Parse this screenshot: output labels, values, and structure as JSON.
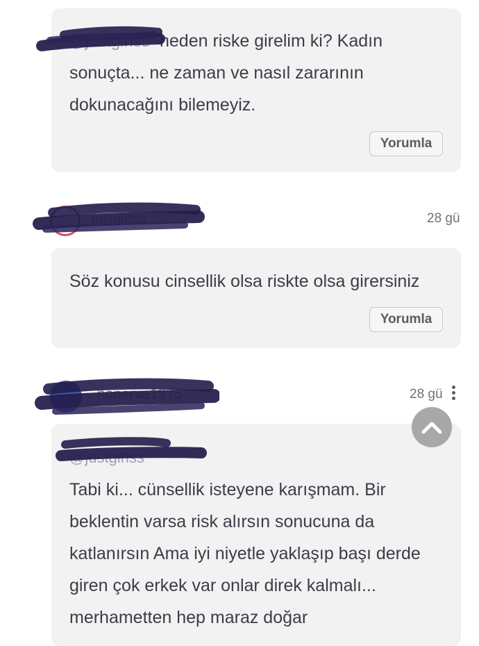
{
  "comments": [
    {
      "mention": "@justgirlss",
      "text_line1": "neden riske girelim ki? Kadın",
      "text_line2": "sonuçta... ne zaman ve nasıl zararının",
      "text_line3": "dokunacağını bilemeyiz.",
      "reply_label": "Yorumla"
    },
    {
      "username": "justgirlss",
      "time": "28 gü",
      "text": "Söz konusu cinsellik olsa riskte olsa girersiniz",
      "reply_label": "Yorumla"
    },
    {
      "username": "noperva1975",
      "time": "28 gü",
      "mention": "@justgirlss",
      "text_line1": "Tabi ki... cünsellik isteyene karışmam. Bir",
      "text_line2": "beklentin varsa risk alırsın sonucuna da",
      "text_line3": "katlanırsın Ama iyi niyetle yaklaşıp başı derde",
      "text_line4": "giren çok erkek var onlar direk kalmalı...",
      "text_line5": "merhametten hep maraz doğar"
    }
  ],
  "icons": {
    "more": "kebab-menu-icon",
    "scroll_top": "chevron-up-icon"
  },
  "colors": {
    "card_bg": "#f2f2f3",
    "scribble": "#241c4a",
    "scroll_button": "#a8a8aa"
  }
}
